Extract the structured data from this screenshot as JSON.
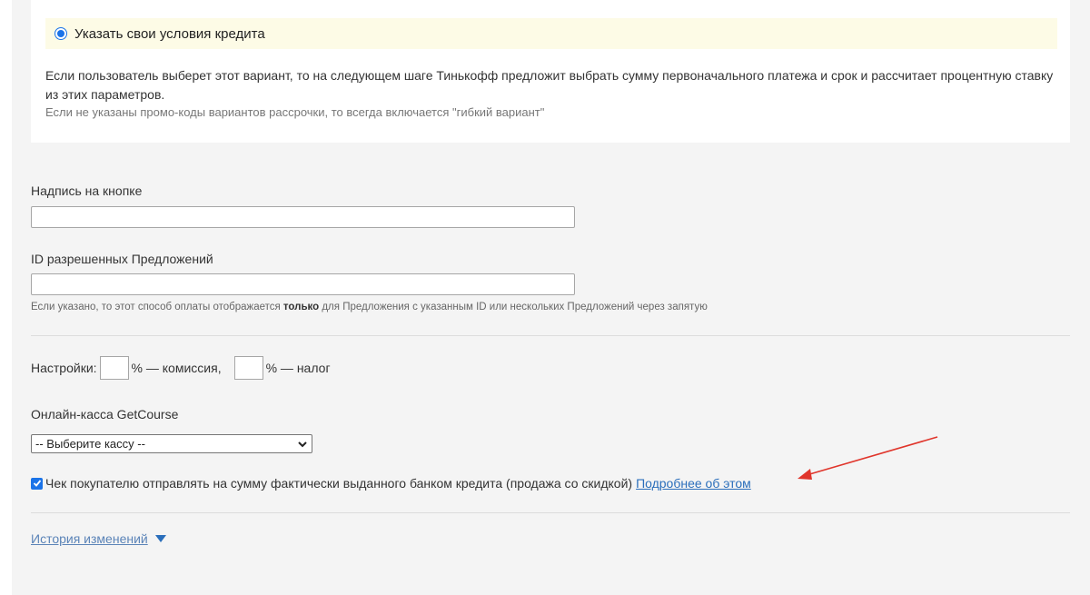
{
  "credit_option": {
    "radio_label": "Указать свои условия кредита",
    "description": "Если пользователь выберет этот вариант, то на следующем шаге Тинькофф предложит выбрать сумму первоначального платежа и срок и рассчитает процентную ставку из этих параметров.",
    "note": "Если не указаны промо-коды вариантов рассрочки, то всегда включается \"гибкий вариант\""
  },
  "button_text": {
    "label": "Надпись на кнопке",
    "value": ""
  },
  "offer_ids": {
    "label": "ID разрешенных Предложений",
    "value": "",
    "hint_before": "Если указано, то этот способ оплаты отображается ",
    "hint_bold": "только",
    "hint_after": " для Предложения с указанным ID или нескольких Предложений через запятую"
  },
  "settings": {
    "label": "Настройки:",
    "commission_value": "",
    "commission_suffix": "% — комиссия,",
    "tax_value": "",
    "tax_suffix": "% — налог"
  },
  "online_cashbox": {
    "label": "Онлайн-касса GetCourse",
    "selected": "-- Выберите кассу --"
  },
  "receipt_option": {
    "checked": true,
    "label": "Чек покупателю отправлять на сумму фактически выданного банком кредита (продажа со скидкой)",
    "link": "Подробнее об этом"
  },
  "history": {
    "label": "История изменений"
  },
  "colors": {
    "accent": "#1a73e8",
    "link": "#2a6ebb",
    "arrow": "#e0352b"
  }
}
